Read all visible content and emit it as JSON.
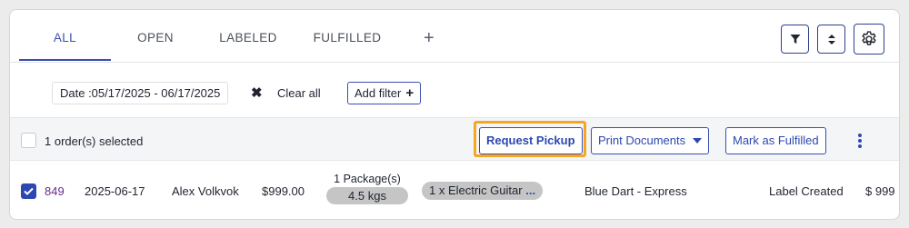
{
  "tabs": [
    {
      "label": "ALL",
      "active": true
    },
    {
      "label": "OPEN",
      "active": false
    },
    {
      "label": "LABELED",
      "active": false
    },
    {
      "label": "FULFILLED",
      "active": false
    }
  ],
  "tab_add_label": "+",
  "toolbar_icons": [
    "filter-icon",
    "sort-icon",
    "gear-icon"
  ],
  "filters": {
    "date_chip": "Date :05/17/2025 - 06/17/2025",
    "clear_icon": "✖",
    "clear_all": "Clear all",
    "add_filter": "Add filter",
    "add_filter_icon": "+"
  },
  "actions": {
    "selected_text": "1 order(s) selected",
    "request_pickup": "Request Pickup",
    "print_documents": "Print Documents",
    "mark_fulfilled": "Mark as Fulfilled"
  },
  "order_row": {
    "checked": true,
    "order_id": "849",
    "date": "2025-06-17",
    "customer": "Alex Volkvok",
    "amount": "$999.00",
    "package_count": "1 Package(s)",
    "weight": "4.5 kgs",
    "items": "1 x Electric Guitar",
    "items_more": "...",
    "carrier": "Blue Dart - Express",
    "status": "Label Created",
    "amount_2": "$ 999"
  },
  "colors": {
    "accent": "#3a4fb0",
    "link_purple": "#6b2c8f",
    "highlight": "#f5a623",
    "pill_grey": "#c5c5c5"
  }
}
